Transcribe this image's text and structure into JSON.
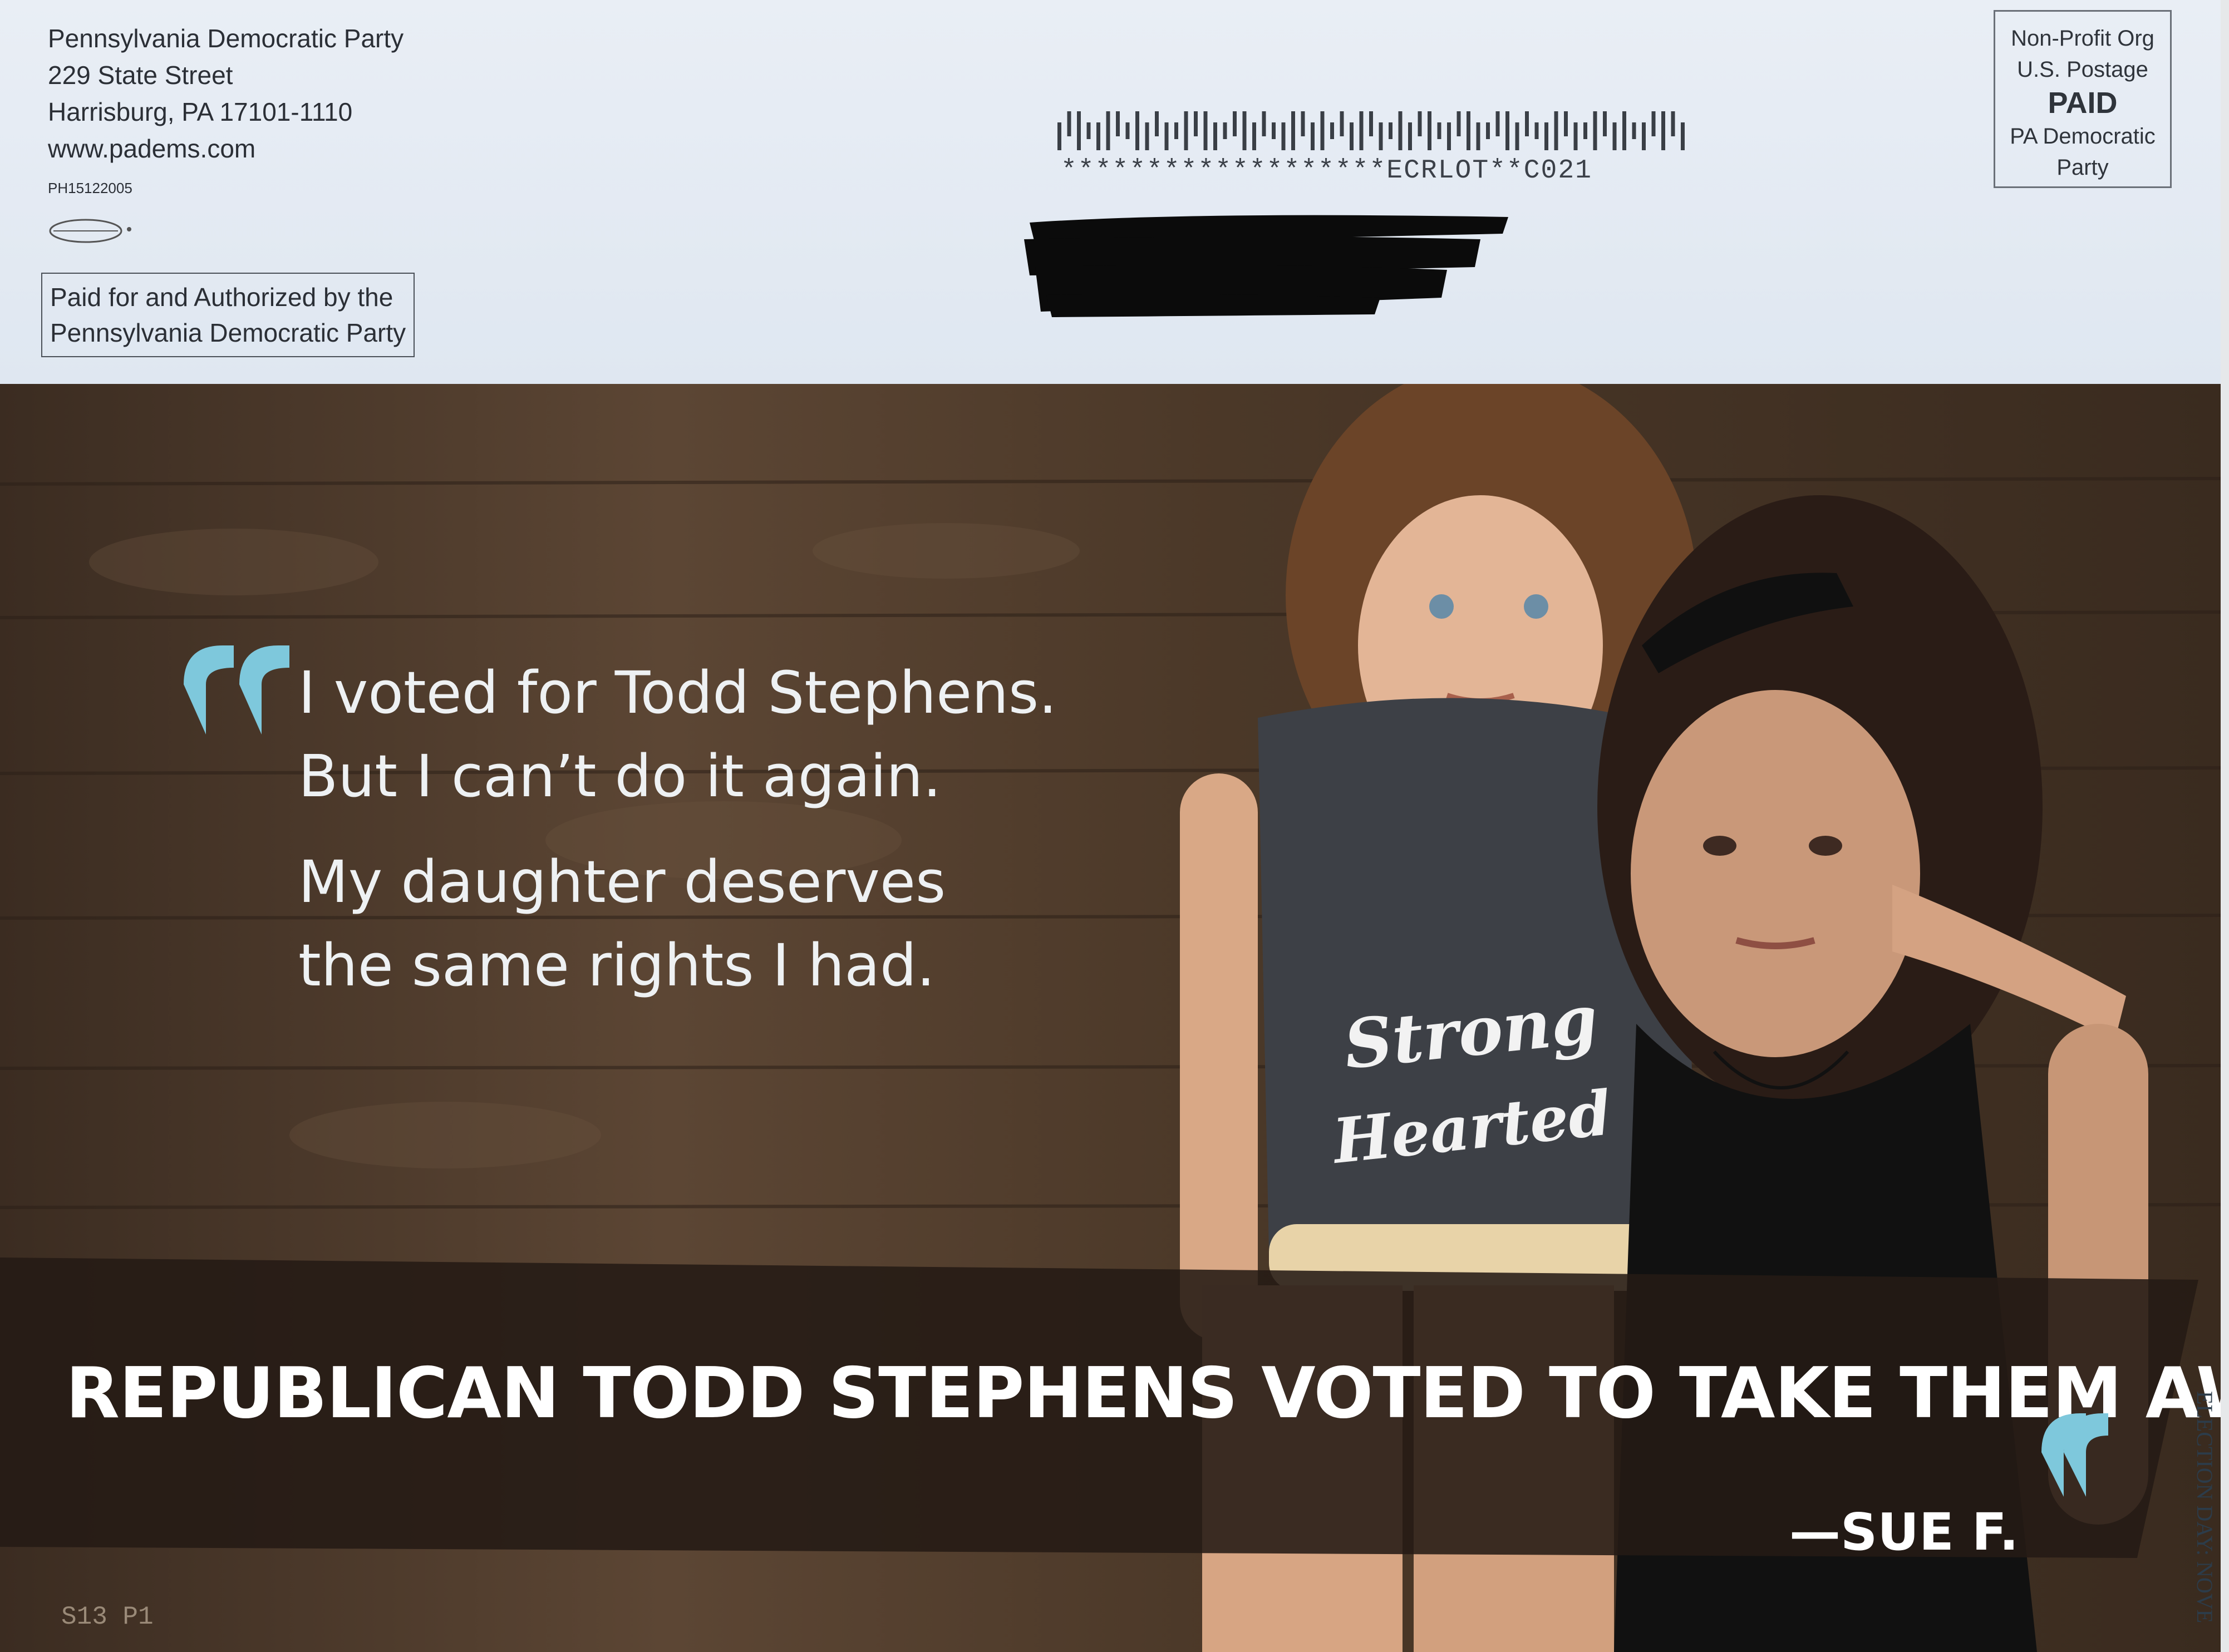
{
  "return_address": {
    "line1": "Pennsylvania Democratic Party",
    "line2": "229 State Street",
    "line3": "Harrisburg, PA 17101-1110",
    "line4": "www.padems.com",
    "code": "PH15122005"
  },
  "disclaimer": {
    "line1": "Paid for and Authorized by the",
    "line2": "Pennsylvania Democratic Party"
  },
  "postage": {
    "line1": "Non-Profit Org",
    "line2": "U.S. Postage",
    "paid": "PAID",
    "line3": "PA Democratic",
    "line4": "Party"
  },
  "barcode_text": "*******************ECRLOT**C021",
  "quote": {
    "line1": "I voted for Todd Stephens.",
    "line2": "But I can’t do it again.",
    "line3": "My daughter deserves",
    "line4": "the same rights I had."
  },
  "headline": "REPUBLICAN TODD STEPHENS VOTED TO TAKE THEM AWAY.",
  "attribution": "—SUE F.",
  "shirt_text": "Strong Hearted",
  "page_code": "S13  P1",
  "side_text": "ELECTION DAY: NOVE",
  "colors": {
    "accent_teal": "#7ec8dc",
    "banner": "#241a14",
    "text_light": "#eef1f3"
  }
}
